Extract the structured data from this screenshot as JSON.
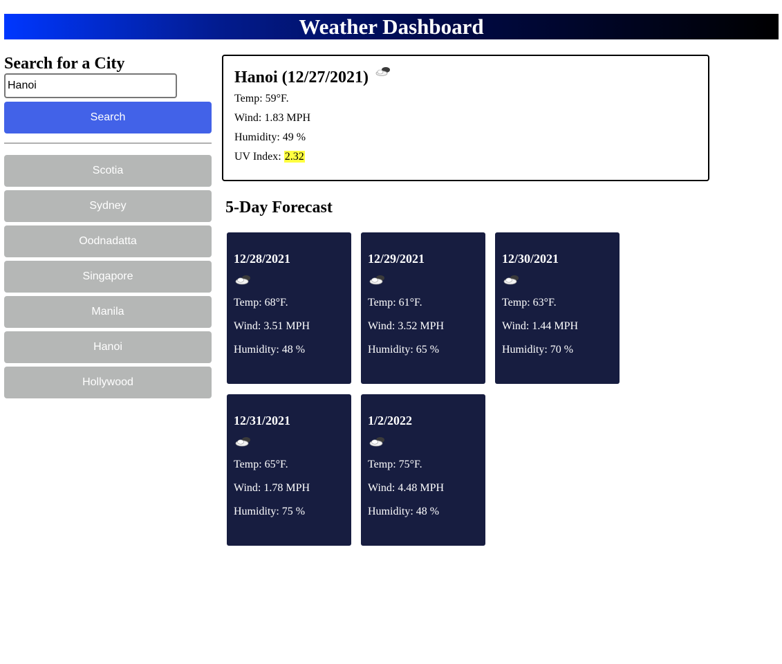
{
  "header": {
    "title": "Weather Dashboard"
  },
  "search": {
    "title": "Search for a City",
    "input_value": "Hanoi",
    "button_label": "Search"
  },
  "history": [
    "Scotia",
    "Sydney",
    "Oodnadatta",
    "Singapore",
    "Manila",
    "Hanoi",
    "Hollywood"
  ],
  "current": {
    "title": "Hanoi (12/27/2021)",
    "icon": "few-clouds-icon",
    "temp": "Temp: 59°F.",
    "wind": "Wind: 1.83 MPH",
    "humidity": "Humidity: 49 %",
    "uv_label": "UV Index: ",
    "uv_value": "2.32",
    "uv_color": "#ffff40"
  },
  "forecast": {
    "title": "5-Day Forecast",
    "days": [
      {
        "date": "12/28/2021",
        "icon": "few-clouds-icon",
        "temp": "Temp: 68°F.",
        "wind": "Wind: 3.51 MPH",
        "humidity": "Humidity: 48 %"
      },
      {
        "date": "12/29/2021",
        "icon": "few-clouds-icon",
        "temp": "Temp: 61°F.",
        "wind": "Wind: 3.52 MPH",
        "humidity": "Humidity: 65 %"
      },
      {
        "date": "12/30/2021",
        "icon": "few-clouds-icon",
        "temp": "Temp: 63°F.",
        "wind": "Wind: 1.44 MPH",
        "humidity": "Humidity: 70 %"
      },
      {
        "date": "12/31/2021",
        "icon": "few-clouds-icon",
        "temp": "Temp: 65°F.",
        "wind": "Wind: 1.78 MPH",
        "humidity": "Humidity: 75 %"
      },
      {
        "date": "1/2/2022",
        "icon": "few-clouds-icon",
        "temp": "Temp: 75°F.",
        "wind": "Wind: 4.48 MPH",
        "humidity": "Humidity: 48 %"
      }
    ]
  },
  "colors": {
    "header_gradient_start": "#0037ff",
    "header_gradient_end": "#000000",
    "search_button": "#4262e8",
    "history_button": "#b5b7b6",
    "card_background": "#171d40"
  }
}
